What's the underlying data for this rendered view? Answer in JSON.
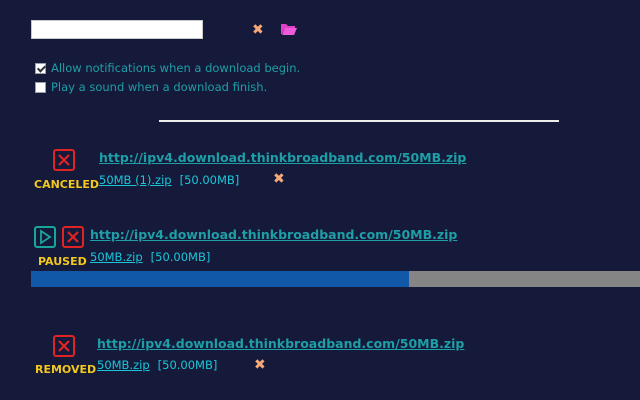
{
  "options": {
    "notify_label": "Allow notifications when a download begin.",
    "notify_checked": true,
    "sound_label": "Play a sound when a download finish.",
    "sound_checked": false
  },
  "downloads": [
    {
      "status": "CANCELED",
      "url": "http://ipv4.download.thinkbroadband.com/50MB.zip",
      "filename": "50MB (1).zip",
      "size": "[50.00MB]"
    },
    {
      "status": "PAUSED",
      "url": "http://ipv4.download.thinkbroadband.com/50MB.zip",
      "filename": "50MB.zip",
      "size": "[50.00MB]",
      "progress": 0.62
    },
    {
      "status": "REMOVED",
      "url": "http://ipv4.download.thinkbroadband.com/50MB.zip",
      "filename": "50MB.zip",
      "size": "[50.00MB]"
    }
  ],
  "icons": {
    "clear": "close-icon",
    "folder": "folder-open-icon",
    "cancel": "cancel-icon",
    "resume": "play-icon"
  },
  "colors": {
    "background": "#15193a",
    "status": "#f2c81e",
    "link": "#1e9fa6",
    "file": "#19c7d8",
    "cancel": "#e02424",
    "resume": "#1aa59a",
    "progress_fill": "#1258a8",
    "progress_track": "#858585",
    "remove": "#f5a878",
    "folder": "#e040c8"
  }
}
